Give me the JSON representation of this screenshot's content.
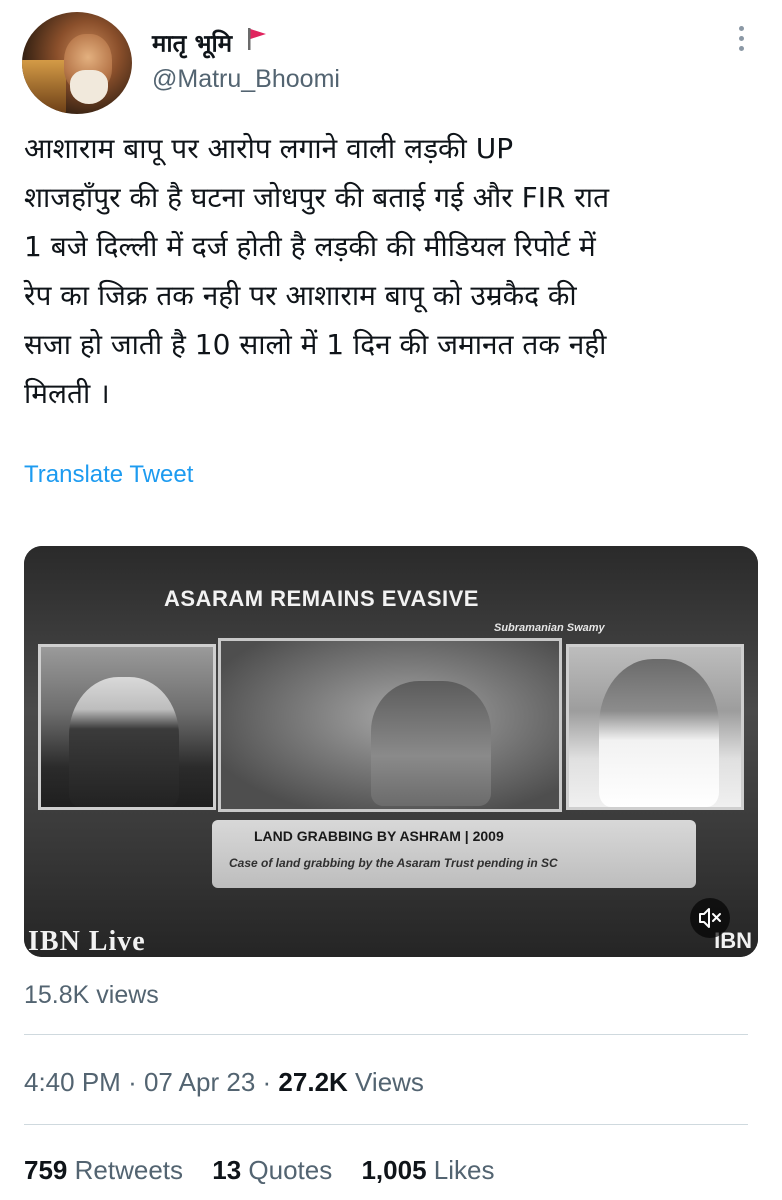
{
  "user": {
    "display_name": "मातृ भूमि",
    "flag_icon": "red-flag-icon",
    "flag_color": "#e0245e",
    "handle": "@Matru_Bhoomi",
    "more_icon": "more-vertical-icon"
  },
  "tweet": {
    "lines": [
      "आशाराम बापू पर आरोप लगाने वाली लड़की UP",
      "शाजहाँपुर की है घटना जोधपुर की बताई गई और FIR रात",
      "1 बजे दिल्ली में दर्ज होती है लड़की की मीडियल रिपोर्ट में",
      "रेप का जिक्र तक नही पर आशाराम बापू को उम्रकैद की",
      "सजा हो जाती है 10 सालो में 1 दिन की जमानत तक नही",
      "मिलती ।"
    ],
    "translate_label": "Translate Tweet"
  },
  "media": {
    "headline": "ASARAM REMAINS EVASIVE",
    "speaker_name": "Subramanian Swamy",
    "ticker_title": "LAND GRABBING BY ASHRAM | 2009",
    "ticker_sub": "Case of land grabbing by the Asaram Trust pending in SC",
    "channel_logo": "IBN Live",
    "channel_logo_right": "IBN",
    "mute_icon": "speaker-muted-icon"
  },
  "video_views": "15.8K views",
  "meta": {
    "time": "4:40 PM",
    "separator": "·",
    "date": "07 Apr 23",
    "views_count": "27.2K",
    "views_label": "Views"
  },
  "stats": {
    "retweets_count": "759",
    "retweets_label": "Retweets",
    "quotes_count": "13",
    "quotes_label": "Quotes",
    "likes_count": "1,005",
    "likes_label": "Likes"
  },
  "colors": {
    "link": "#1d9bf0",
    "secondary_text": "#536471",
    "primary_text": "#0f1419",
    "divider": "#cfd9de"
  }
}
